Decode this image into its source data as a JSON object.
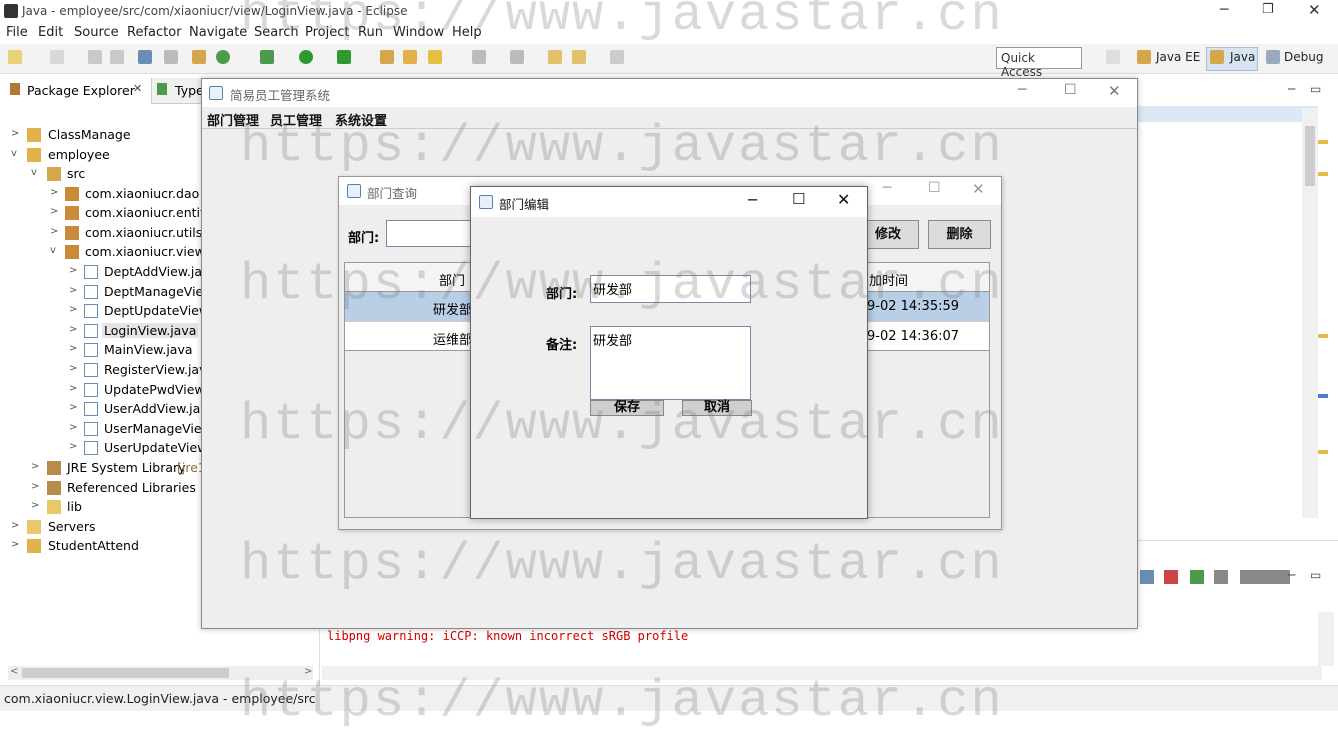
{
  "eclipse": {
    "title": "Java - employee/src/com/xiaoniucr/view/LoginView.java - Eclipse",
    "menu": [
      "File",
      "Edit",
      "Source",
      "Refactor",
      "Navigate",
      "Search",
      "Project",
      "Run",
      "Window",
      "Help"
    ],
    "quick_access": "Quick Access",
    "perspectives": [
      "Java EE",
      "Java",
      "Debug"
    ],
    "tabs": {
      "package_explorer": "Package Explorer",
      "type": "Type"
    },
    "tree": [
      {
        "label": "ClassManage"
      },
      {
        "label": "employee"
      },
      {
        "label": "src"
      },
      {
        "label": "com.xiaoniucr.dao"
      },
      {
        "label": "com.xiaoniucr.entity"
      },
      {
        "label": "com.xiaoniucr.utils"
      },
      {
        "label": "com.xiaoniucr.view"
      },
      {
        "label": "DeptAddView.java"
      },
      {
        "label": "DeptManageView"
      },
      {
        "label": "DeptUpdateView."
      },
      {
        "label": "LoginView.java"
      },
      {
        "label": "MainView.java"
      },
      {
        "label": "RegisterView.java"
      },
      {
        "label": "UpdatePwdView.j"
      },
      {
        "label": "UserAddView.java"
      },
      {
        "label": "UserManageView"
      },
      {
        "label": "UserUpdateView."
      },
      {
        "label": "JRE System Library",
        "suffix": "[jre1"
      },
      {
        "label": "Referenced Libraries"
      },
      {
        "label": "lib"
      },
      {
        "label": "Servers"
      },
      {
        "label": "StudentAttend"
      }
    ],
    "console_text": "libpng warning: iCCP: known incorrect sRGB profile",
    "status": "com.xiaoniucr.view.LoginView.java - employee/src"
  },
  "main_window": {
    "title": "简易员工管理系统",
    "menu": [
      "部门管理",
      "员工管理",
      "系统设置"
    ]
  },
  "query_frame": {
    "title": "部门查询",
    "dept_label": "部门:",
    "buttons": {
      "modify": "修改",
      "delete": "删除"
    },
    "columns": [
      "部门",
      "加时间"
    ],
    "rows": [
      {
        "dept": "研发部",
        "time": "9-02 14:35:59"
      },
      {
        "dept": "运维部",
        "time": "9-02 14:36:07"
      }
    ]
  },
  "edit_dialog": {
    "title": "部门编辑",
    "dept_label": "部门:",
    "dept_value": "研发部",
    "remark_label": "备注:",
    "remark_value": "研发部",
    "save": "保存",
    "cancel": "取消"
  },
  "watermark": "https://www.javastar.cn"
}
